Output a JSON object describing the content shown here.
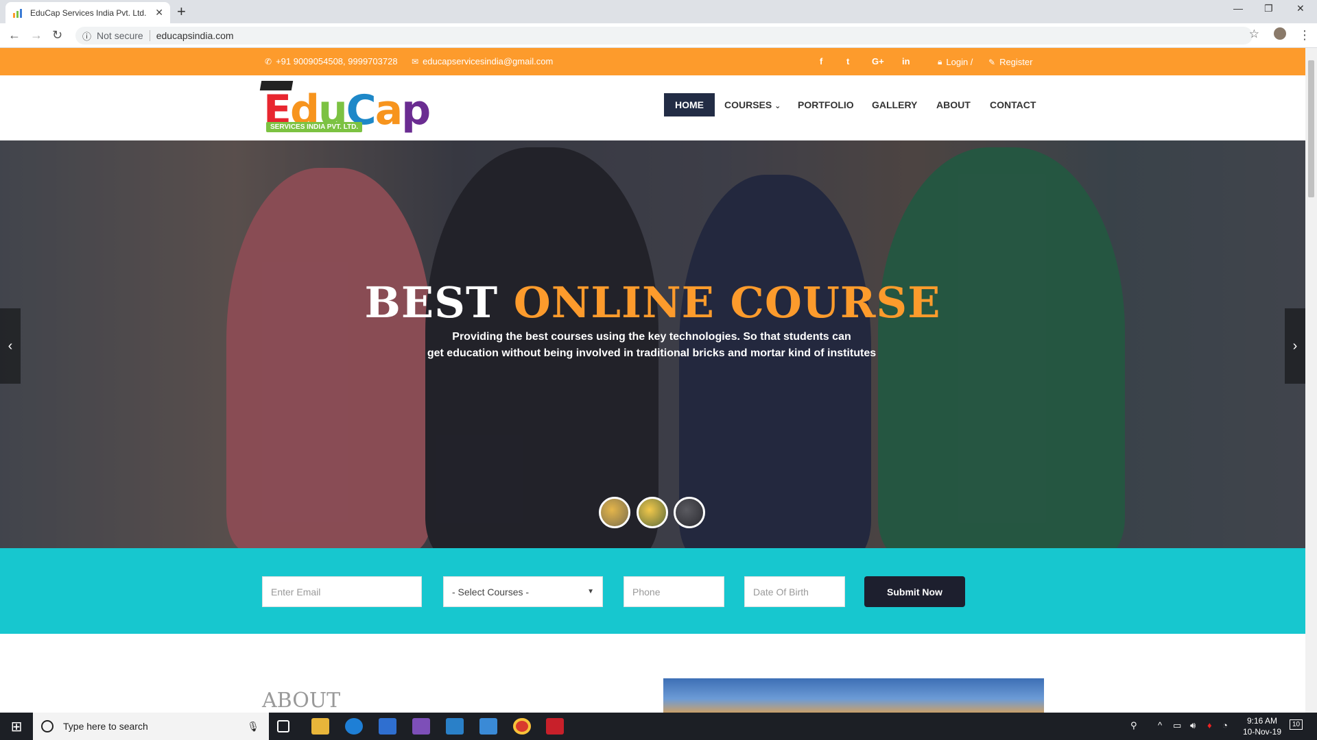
{
  "browser": {
    "tab_title": "EduCap Services India Pvt. Ltd.",
    "tab_close": "✕",
    "new_tab": "+",
    "security": "Not secure",
    "url": "educapsindia.com",
    "icons": [
      "back-icon",
      "forward-icon",
      "reload-icon",
      "info-icon",
      "star-icon",
      "profile-icon",
      "menu-icon"
    ]
  },
  "topbar": {
    "phone": "+91 9009054508, 9999703728",
    "email": "educapservicesindia@gmail.com",
    "social": [
      "f",
      "t",
      "G+",
      "in"
    ],
    "login": "Login /",
    "register": "Register"
  },
  "logo": {
    "word": "EduCap",
    "tagline": "SERVICES INDIA PVT. LTD."
  },
  "nav": {
    "items": [
      "HOME",
      "COURSES",
      "PORTFOLIO",
      "GALLERY",
      "ABOUT",
      "CONTACT"
    ],
    "active": "HOME",
    "courses_caret": "⌄"
  },
  "hero": {
    "title_part1": "BEST",
    "title_part2": "ONLINE COURSE",
    "text_line1": "Providing the best courses using the key technologies. So that students can",
    "text_line2": "get education without being involved in traditional bricks and mortar kind of institutes",
    "prev": "‹",
    "next": "›"
  },
  "form": {
    "email_placeholder": "Enter Email",
    "course_select": "- Select Courses -",
    "phone_placeholder": "Phone",
    "dob_placeholder": "Date Of Birth",
    "submit": "Submit Now"
  },
  "about": {
    "heading": "ABOUT"
  },
  "taskbar": {
    "search_placeholder": "Type here to search",
    "time": "9:16 AM",
    "date": "10-Nov-19",
    "notifications": "10"
  },
  "colors": {
    "accent_orange": "#fd9b2c",
    "teal": "#17c7cf",
    "navy": "#222c45"
  }
}
